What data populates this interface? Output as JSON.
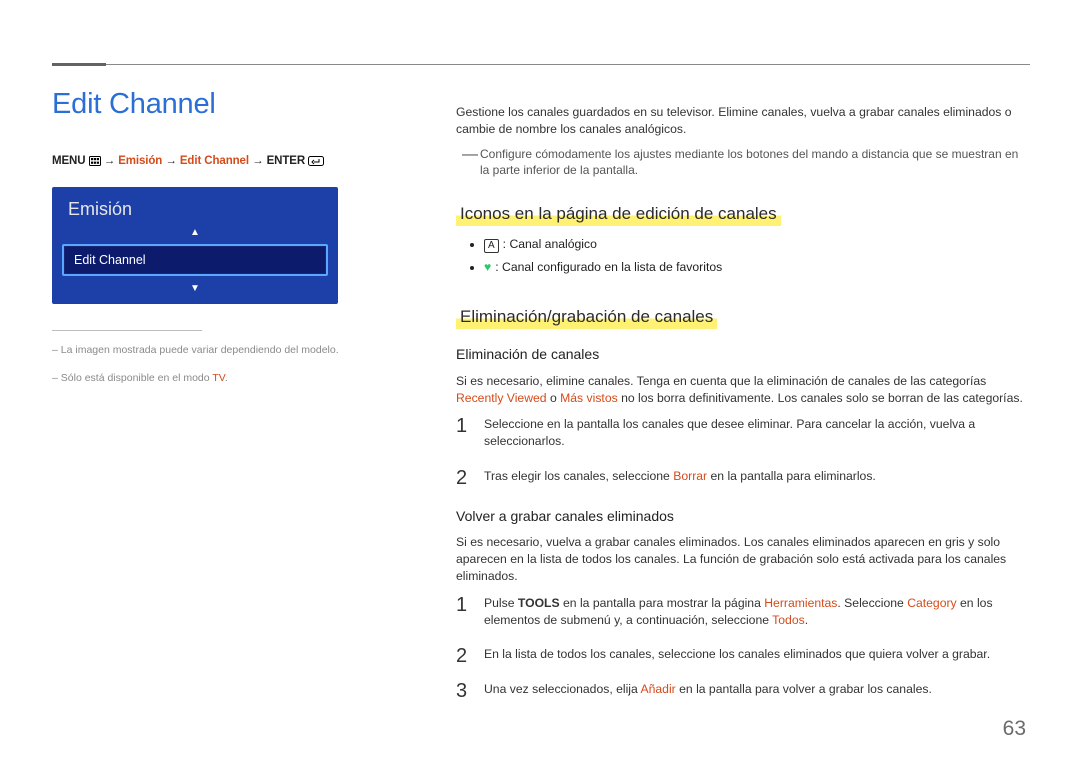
{
  "page_number": "63",
  "left": {
    "title": "Edit Channel",
    "menu_path": {
      "lead": "MENU",
      "arrow": "→",
      "item1": "Emisión",
      "item2": "Edit Channel",
      "enter": "ENTER"
    },
    "tv_card": {
      "header": "Emisión",
      "selected": "Edit Channel",
      "arrow_up": "▲",
      "arrow_down": "▼"
    },
    "note1": "La imagen mostrada puede variar dependiendo del modelo.",
    "note2_a": "Sólo está disponible en el modo ",
    "note2_b": "TV",
    "note2_c": "."
  },
  "right": {
    "intro": "Gestione los canales guardados en su televisor. Elimine canales, vuelva a grabar canales eliminados o cambie de nombre los canales analógicos.",
    "tip_mark": "―",
    "tip": "Configure cómodamente los ajustes mediante los botones del mando a distancia que se muestran en la parte inferior de la pantalla.",
    "h2_icons": "Iconos en la página de edición de canales",
    "icons": {
      "analog_badge": "A",
      "analog_label": ": Canal analógico",
      "fav_heart": "♥",
      "fav_label": ": Canal configurado en la lista de favoritos"
    },
    "h2_elim": "Eliminación/grabación de canales",
    "h3_elim": "Eliminación de canales",
    "elim_intro_a": "Si es necesario, elimine canales. Tenga en cuenta que la eliminación de canales de las categorías ",
    "elim_intro_b": "Recently Viewed",
    "elim_intro_c": " o ",
    "elim_intro_d": "Más vistos",
    "elim_intro_e": " no los borra definitivamente. Los canales solo se borran de las categorías.",
    "elim_steps": {
      "s1": "Seleccione en la pantalla los canales que desee eliminar. Para cancelar la acción, vuelva a seleccionarlos.",
      "s2_a": "Tras elegir los canales, seleccione ",
      "s2_b": "Borrar",
      "s2_c": " en la pantalla para eliminarlos."
    },
    "h3_regrab": "Volver a grabar canales eliminados",
    "regrab_intro": "Si es necesario, vuelva a grabar canales eliminados. Los canales eliminados aparecen en gris y solo aparecen en la lista de todos los canales. La función de grabación solo está activada para los canales eliminados.",
    "regrab_steps": {
      "s1_a": "Pulse ",
      "s1_b": "TOOLS",
      "s1_c": " en la pantalla para mostrar la página ",
      "s1_d": "Herramientas",
      "s1_e": ". Seleccione ",
      "s1_f": "Category",
      "s1_g": " en los elementos de submenú y, a continuación, seleccione ",
      "s1_h": "Todos",
      "s1_i": ".",
      "s2": "En la lista de todos los canales, seleccione los canales eliminados que quiera volver a grabar.",
      "s3_a": "Una vez seleccionados, elija ",
      "s3_b": "Añadir",
      "s3_c": " en la pantalla para volver a grabar los canales."
    },
    "nums": {
      "n1": "1",
      "n2": "2",
      "n3": "3"
    }
  }
}
